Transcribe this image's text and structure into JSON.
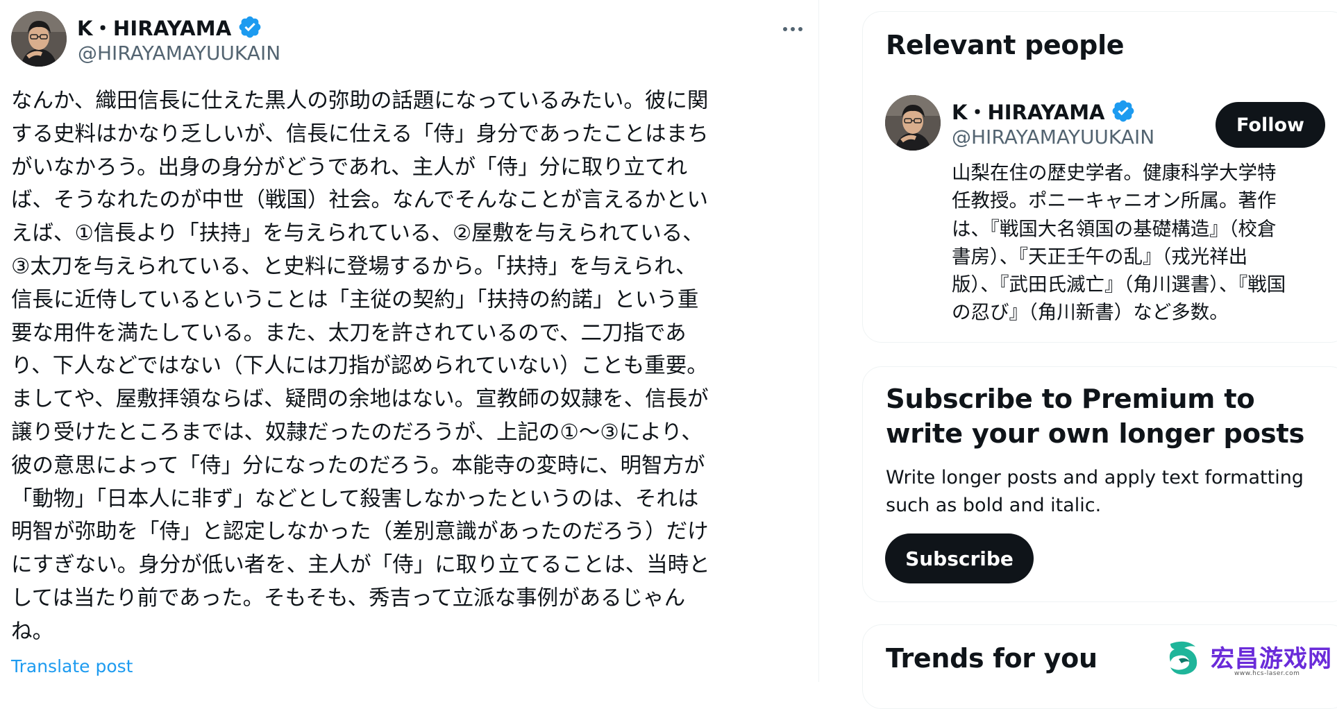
{
  "post": {
    "author_name": "K・HIRAYAMA",
    "author_handle": "@HIRAYAMAYUUKAIN",
    "lines": [
      "なんか、織田信長に仕えた黒人の弥助の話題になっているみたい。彼に関",
      "する史料はかなり乏しいが、信長に仕える「侍」身分であったことはまち",
      "がいなかろう。出身の身分がどうであれ、主人が「侍」分に取り立てれ",
      "ば、そうなれたのが中世（戦国）社会。なんでそんなことが言えるかとい",
      "えば、①信長より「扶持」を与えられている、②屋敷を与えられている、",
      "③太刀を与えられている、と史料に登場するから。「扶持」を与えられ、",
      "信長に近侍しているということは「主従の契約」「扶持の約諾」という重",
      "要な用件を満たしている。また、太刀を許されているので、二刀指であ",
      "り、下人などではない（下人には刀指が認められていない）ことも重要。",
      "ましてや、屋敷拝領ならば、疑問の余地はない。宣教師の奴隷を、信長が",
      "譲り受けたところまでは、奴隷だったのだろうが、上記の①〜③により、",
      "彼の意思によって「侍」分になったのだろう。本能寺の変時に、明智方が",
      "「動物」「日本人に非ず」などとして殺害しなかったというのは、それは",
      "明智が弥助を「侍」と認定しなかった（差別意識があったのだろう）だけ",
      "にすぎない。身分が低い者を、主人が「侍」に取り立てることは、当時と",
      "しては当たり前であった。そもそも、秀吉って立派な事例があるじゃん",
      "ね。"
    ],
    "translate_label": "Translate post"
  },
  "sidebar": {
    "relevant_people": {
      "title": "Relevant people",
      "person": {
        "name": "K・HIRAYAMA",
        "handle": "@HIRAYAMAYUUKAIN",
        "follow_label": "Follow",
        "bio_lines": [
          "山梨在住の歴史学者。健康科学大学特",
          "任教授。ポニーキャニオン所属。著作",
          "は、『戦国大名領国の基礎構造』（校倉",
          "書房）、『天正壬午の乱』（戎光祥出",
          "版）、『武田氏滅亡』（角川選書）、『戦国",
          "の忍び』（角川新書）など多数。"
        ]
      }
    },
    "premium": {
      "title": "Subscribe to Premium to write your own longer posts",
      "description": "Write longer posts and apply text formatting such as bold and italic.",
      "button_label": "Subscribe"
    },
    "trends": {
      "title": "Trends for you"
    }
  },
  "watermark": {
    "text": "宏昌游戏网",
    "subtext": "www.hcs-laser.com"
  },
  "colors": {
    "text": "#0f1419",
    "secondary": "#536471",
    "link": "#1d9bf0",
    "verified": "#1d9bf0",
    "button_bg": "#0f1419",
    "divider": "#eff3f4"
  },
  "icons": {
    "verified": "verified-badge-icon",
    "more": "more-dots-icon",
    "watermark_logo": "dragon-logo-icon"
  }
}
